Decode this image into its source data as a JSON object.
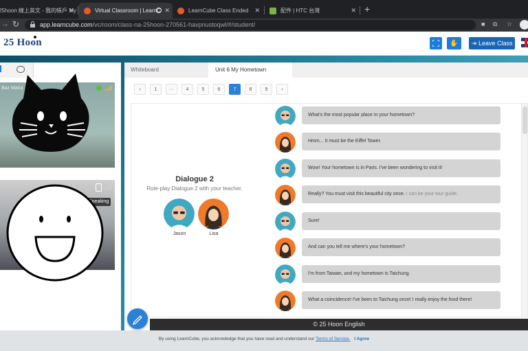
{
  "browser": {
    "tabs": [
      {
        "title": "25hoon 線上英文 - 我的帳戶 My",
        "favicon_color": "#c8352f"
      },
      {
        "title": "Virtual Classroom | LearnC",
        "favicon_color": "#e65b28"
      },
      {
        "title": "LearnCube Class Ended",
        "favicon_color": "#e65b28"
      },
      {
        "title": "配件 | HTC 台灣",
        "favicon_color": "#7cb342"
      }
    ],
    "new_tab": "+",
    "url_host": "app.learncube.com",
    "url_path": "/vc/room/class-na-25hoon-270561-havpnustoqwl/#/student/"
  },
  "header": {
    "logo_number": "25",
    "logo_word": "Hoon",
    "fullscreen_icon": "expand-icon",
    "hand_icon": "raise-hand-icon",
    "leave_label": "Leave Class",
    "accent": "#1a7de0"
  },
  "left_panel": {
    "participant_name": "Baz Maria",
    "speaking_label": "Speaking"
  },
  "main": {
    "tabs": [
      "Whiteboard",
      "Unit 6 My Hometown"
    ],
    "pager": [
      "‹",
      "1",
      "···",
      "4",
      "5",
      "6",
      "7",
      "8",
      "9",
      "›"
    ],
    "current_page": "7",
    "dialogue": {
      "title": "Dialogue 2",
      "subtitle": "Role-play Dialogue 2  with your teacher.",
      "speaker1": "Jason",
      "speaker2": "Lisa"
    },
    "messages": [
      {
        "speaker": "jason",
        "text": "What's the most popular place in your hometown?",
        "hint": ""
      },
      {
        "speaker": "lisa",
        "text": "Hmm... It must be the Eiffel Tower.",
        "hint": ""
      },
      {
        "speaker": "jason",
        "text": "Wow! Your hometown is in Paris. I've been wondering to visit it!",
        "hint": ""
      },
      {
        "speaker": "lisa",
        "text": "Really? You must visit this beautiful city once.",
        "hint": "  I can be your tour guide."
      },
      {
        "speaker": "jason",
        "text": "Sure!",
        "hint": ""
      },
      {
        "speaker": "lisa",
        "text": "And can you tell me where's your hometown?",
        "hint": ""
      },
      {
        "speaker": "jason",
        "text": "I'm from Taiwan, and my hometown is Taichung.",
        "hint": ""
      },
      {
        "speaker": "lisa",
        "text": "What a coincidence! I've been to Taichung once! I really enjoy the food there!",
        "hint": ""
      }
    ]
  },
  "footer": {
    "copyright": "© 25 Hoon English",
    "consent_prefix": "By using LearnCube, you acknowledge that you have read and understand our ",
    "consent_link": "Terms of Service.",
    "agree": "I Agree"
  }
}
